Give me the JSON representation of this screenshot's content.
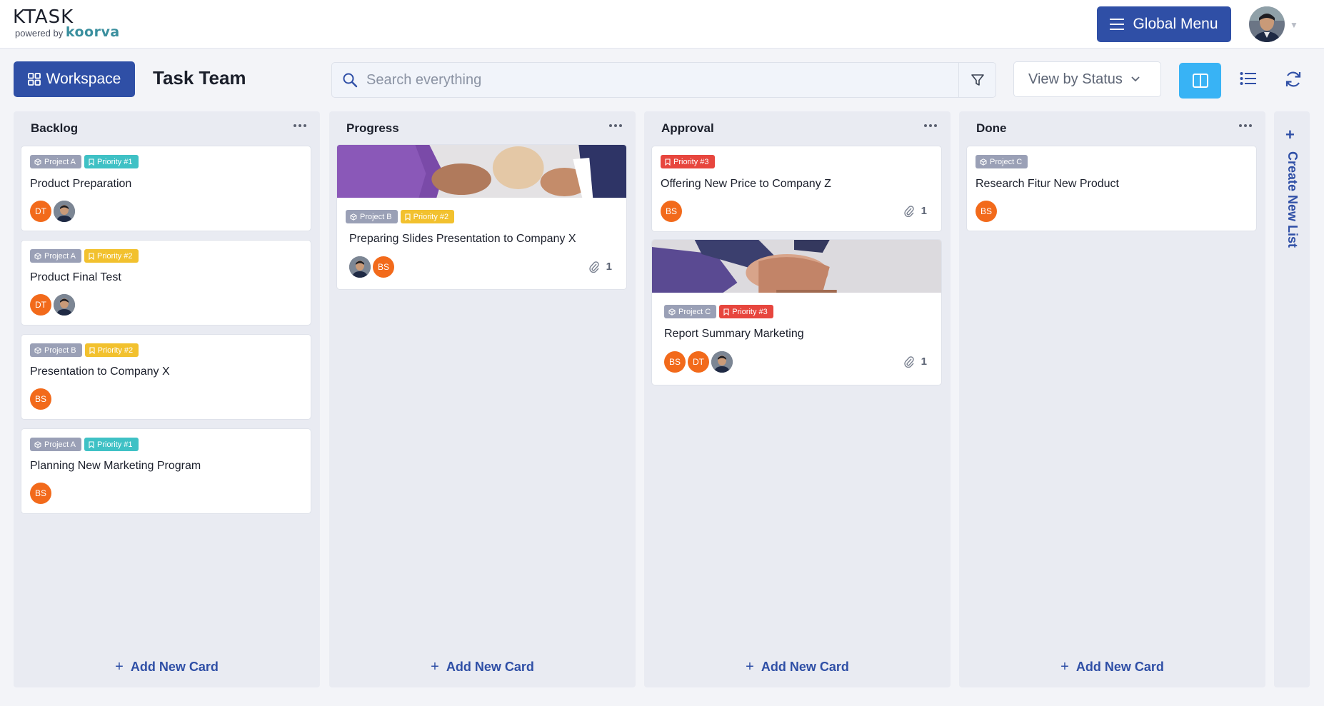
{
  "brand": {
    "name": "KTASK",
    "powered_by": "powered by",
    "partner": "koorva"
  },
  "header": {
    "global_menu_label": "Global Menu",
    "hamburger_icon": "menu-icon",
    "avatar_icon": "user-avatar"
  },
  "toolbar": {
    "workspace_label": "Workspace",
    "team_title": "Task Team",
    "search_placeholder": "Search everything",
    "view_select_label": "View by Status"
  },
  "colors": {
    "primary": "#2f4fa6",
    "accent": "#38b3f5",
    "avatar_orange": "#f26a1b",
    "priority1": "#3fc1c5",
    "priority2": "#f2c12e",
    "priority3": "#e7463e",
    "project": "#9aa0b6"
  },
  "columns": [
    {
      "title": "Backlog",
      "add_card_label": "Add New Card",
      "cards": [
        {
          "tags": [
            "Project A",
            "Priority #1"
          ],
          "title": "Product Preparation",
          "avatars": [
            "DT",
            "photo"
          ]
        },
        {
          "tags": [
            "Project A",
            "Priority #2"
          ],
          "title": "Product Final Test",
          "avatars": [
            "DT",
            "photo"
          ]
        },
        {
          "tags": [
            "Project B",
            "Priority #2"
          ],
          "title": "Presentation to Company X",
          "avatars": [
            "BS"
          ]
        },
        {
          "tags": [
            "Project A",
            "Priority #1"
          ],
          "title": "Planning New Marketing Program",
          "avatars": [
            "BS"
          ]
        }
      ]
    },
    {
      "title": "Progress",
      "add_card_label": "Add New Card",
      "cards": [
        {
          "cover": "fist-bump-image",
          "tags": [
            "Project B",
            "Priority #2"
          ],
          "title": "Preparing Slides Presentation to Company X",
          "avatars": [
            "photo",
            "BS"
          ],
          "attachments": "1"
        }
      ]
    },
    {
      "title": "Approval",
      "add_card_label": "Add New Card",
      "cards": [
        {
          "tags": [
            "Priority #3"
          ],
          "title": "Offering New Price to Company Z",
          "avatars": [
            "BS"
          ],
          "attachments": "1"
        },
        {
          "cover": "stacked-hands-image",
          "tags": [
            "Project C",
            "Priority #3"
          ],
          "title": "Report Summary Marketing",
          "avatars": [
            "BS",
            "DT",
            "photo"
          ],
          "attachments": "1"
        }
      ]
    },
    {
      "title": "Done",
      "add_card_label": "Add New Card",
      "cards": [
        {
          "tags": [
            "Project C"
          ],
          "title": "Research Fitur New Product",
          "avatars": [
            "BS"
          ]
        }
      ]
    }
  ],
  "create_list_label": "Create New List"
}
